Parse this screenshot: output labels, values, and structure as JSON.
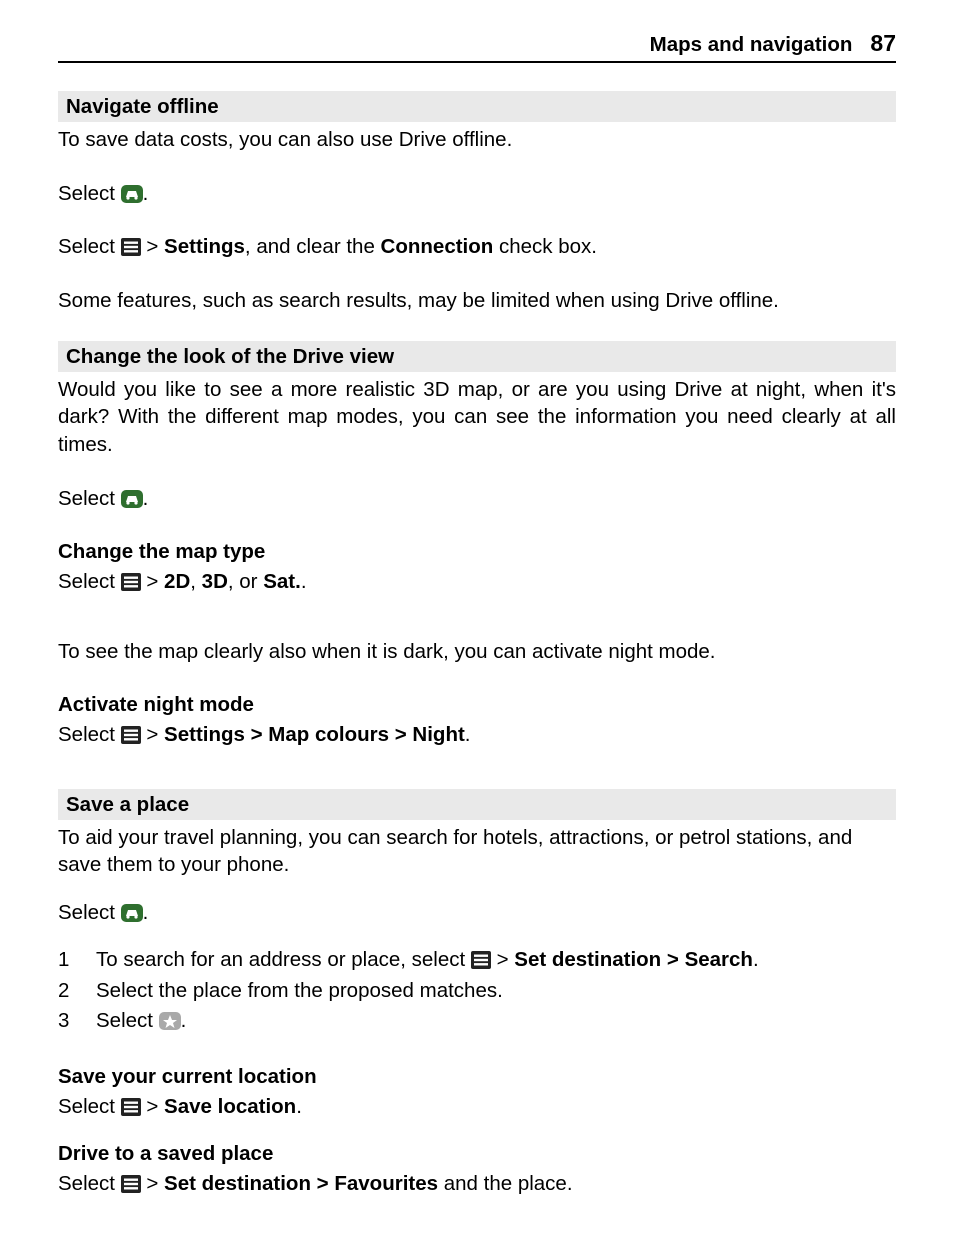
{
  "header": {
    "title": "Maps and navigation",
    "page": "87"
  },
  "sec1": {
    "heading": "Navigate offline",
    "p1": "To save data costs, you can also use Drive offline.",
    "p2_a": "Select ",
    "p2_b": ".",
    "p3_a": "Select ",
    "p3_b": " > ",
    "p3_c": "Settings",
    "p3_d": ", and clear the ",
    "p3_e": "Connection",
    "p3_f": " check box.",
    "p4": "Some features, such as search results, may be limited when using Drive offline."
  },
  "sec2": {
    "heading": "Change the look of the Drive view",
    "p1": "Would you like to see a more realistic 3D map, or are you using Drive at night, when it's dark? With the different map modes, you can see the information you need clearly at all times.",
    "p2_a": "Select ",
    "p2_b": ".",
    "h1": "Change the map type",
    "p3_a": "Select ",
    "p3_b": " > ",
    "p3_c": "2D",
    "p3_d": ", ",
    "p3_e": "3D",
    "p3_f": ", or ",
    "p3_g": "Sat.",
    "p3_h": ".",
    "p4": "To see the map clearly also when it is dark, you can activate night mode.",
    "h2": "Activate night mode",
    "p5_a": "Select ",
    "p5_b": " > ",
    "p5_c": "Settings",
    "p5_d": " > ",
    "p5_e": "Map colours",
    "p5_f": " > ",
    "p5_g": "Night",
    "p5_h": "."
  },
  "sec3": {
    "heading": "Save a place",
    "p1": "To aid your travel planning, you can search for hotels, attractions, or petrol stations, and save them to your phone.",
    "p2_a": "Select ",
    "p2_b": ".",
    "steps": {
      "n1": "1",
      "s1_a": "To search for an address or place, select ",
      "s1_b": " > ",
      "s1_c": "Set destination",
      "s1_d": " > ",
      "s1_e": "Search",
      "s1_f": ".",
      "n2": "2",
      "s2": "Select the place from the proposed matches.",
      "n3": "3",
      "s3_a": "Select ",
      "s3_b": "."
    },
    "h1": "Save your current location",
    "p3_a": "Select ",
    "p3_b": " > ",
    "p3_c": "Save location",
    "p3_d": ".",
    "h2": "Drive to a saved place",
    "p4_a": "Select ",
    "p4_b": " > ",
    "p4_c": "Set destination",
    "p4_d": " > ",
    "p4_e": "Favourites",
    "p4_f": " and the place."
  }
}
